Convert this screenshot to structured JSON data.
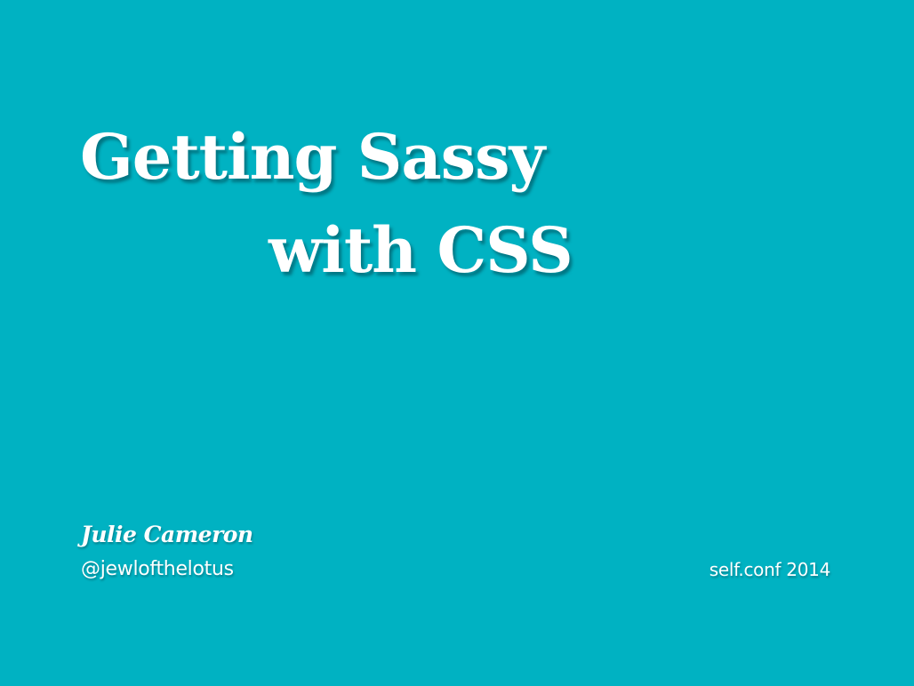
{
  "slide": {
    "background_color": "#00b2c2",
    "text_color": "#ffffff",
    "title_lines": [
      "Getting Sassy",
      "with CSS"
    ],
    "author_name": "Julie Cameron",
    "author_handle": "@jewlofthelotus",
    "event": "self.conf  2014"
  }
}
